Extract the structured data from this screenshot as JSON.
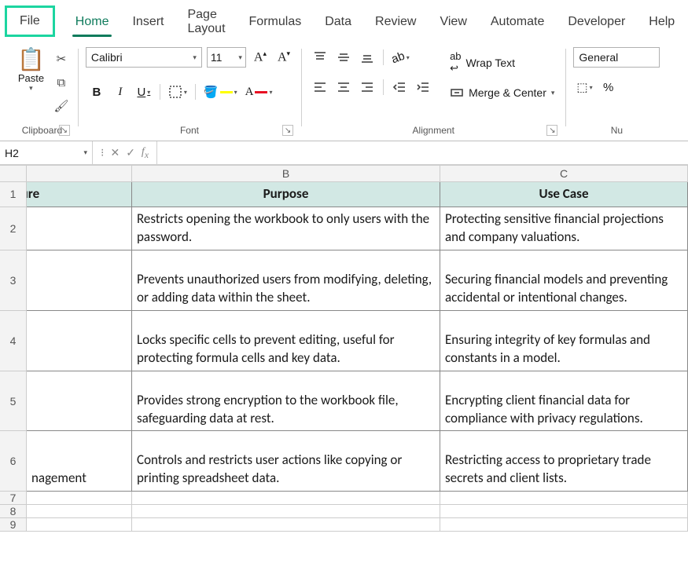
{
  "tabs": {
    "file": "File",
    "home": "Home",
    "insert": "Insert",
    "page_layout": "Page Layout",
    "formulas": "Formulas",
    "data": "Data",
    "review": "Review",
    "view": "View",
    "automate": "Automate",
    "developer": "Developer",
    "help": "Help"
  },
  "ribbon": {
    "clipboard": {
      "paste": "Paste",
      "label": "Clipboard"
    },
    "font": {
      "name": "Calibri",
      "size": "11",
      "label": "Font"
    },
    "alignment": {
      "wrap": "Wrap Text",
      "merge": "Merge & Center",
      "label": "Alignment"
    },
    "number": {
      "format": "General",
      "label": "Nu"
    }
  },
  "namebox": "H2",
  "formula": "",
  "columns": [
    "B",
    "C"
  ],
  "rows": [
    "1",
    "2",
    "3",
    "4",
    "5",
    "6",
    "7",
    "8",
    "9"
  ],
  "grid": {
    "headers": {
      "a": "eature",
      "b": "Purpose",
      "c": "Use Case"
    },
    "data": [
      {
        "a": "",
        "b": "Restricts opening the workbook to only users with the password.",
        "c": "Protecting sensitive financial projections and company valuations."
      },
      {
        "a": "",
        "b": "Prevents unauthorized users from modifying, deleting, or adding data within the sheet.",
        "c": "Securing financial models and preventing accidental or intentional changes."
      },
      {
        "a": "",
        "b": "Locks specific cells to prevent editing, useful for protecting formula cells and key data.",
        "c": "Ensuring integrity of key formulas and constants in a model."
      },
      {
        "a": "",
        "b": "Provides strong encryption to the workbook file, safeguarding data at rest.",
        "c": "Encrypting client financial data for compliance with privacy regulations."
      },
      {
        "a": "nagement",
        "b": "Controls and restricts user actions like copying or printing spreadsheet data.",
        "c": "Restricting access to proprietary trade secrets and client lists."
      }
    ]
  }
}
